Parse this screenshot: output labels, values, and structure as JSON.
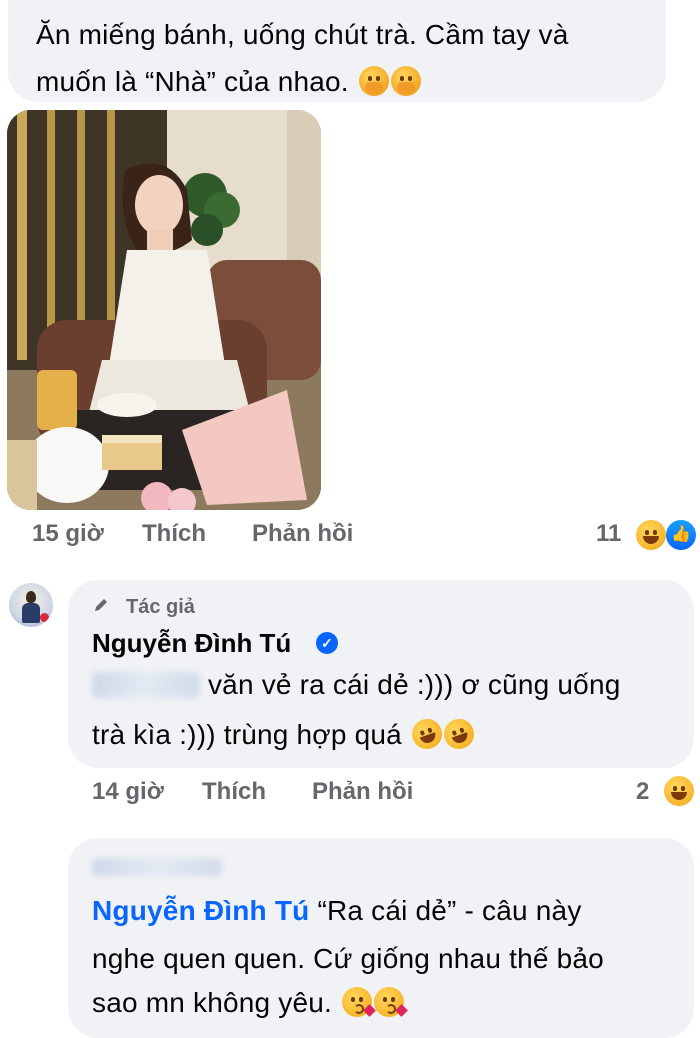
{
  "comment1": {
    "line1": "Ăn miếng bánh, uống chút trà. Cầm tay và",
    "line2": "muốn là “Nhà” của nhao.",
    "emojis": [
      "hand-over-mouth-emoji",
      "hand-over-mouth-emoji"
    ],
    "time": "15 giờ",
    "like_label": "Thích",
    "reply_label": "Phản hồi",
    "reaction_count": "11",
    "reactions": [
      "laughing-emoji",
      "like-icon"
    ]
  },
  "reply1": {
    "author_tag": "Tác giả",
    "author_name": "Nguyễn Đình Tú",
    "line1": "văn vẻ ra cái dẻ :))) ơ cũng uống",
    "line2": "trà kìa :))) trùng hợp quá",
    "emojis": [
      "rolling-laughing-emoji",
      "rolling-laughing-emoji"
    ],
    "time": "14 giờ",
    "like_label": "Thích",
    "reply_label": "Phản hồi",
    "reaction_count": "2",
    "reactions": [
      "laughing-emoji"
    ]
  },
  "reply2": {
    "mention": "Nguyễn Đình Tú",
    "line1": "“Ra cái dẻ” - câu này",
    "line2": "nghe quen quen. Cứ giống nhau thế bảo",
    "line3": "sao mn không yêu.",
    "emojis": [
      "kissing-emoji",
      "kissing-emoji"
    ]
  }
}
